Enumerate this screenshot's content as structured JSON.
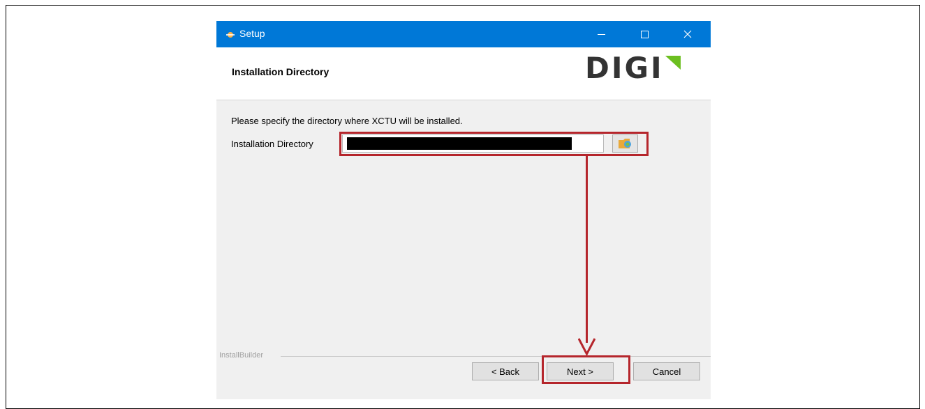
{
  "window": {
    "title": "Setup",
    "icons": {
      "app": "setup-icon",
      "minimize": "minimize-icon",
      "maximize": "maximize-icon",
      "close": "close-icon"
    }
  },
  "header": {
    "title": "Installation Directory",
    "logo_text": "DIGI",
    "logo_accent_color": "#6cbf20"
  },
  "body": {
    "prompt": "Please specify the directory where XCTU will be installed.",
    "directory_label": "Installation Directory",
    "directory_value": "",
    "browse_icon": "folder-icon"
  },
  "footer": {
    "brand": "InstallBuilder",
    "back_label": "< Back",
    "next_label": "Next >",
    "cancel_label": "Cancel"
  },
  "colors": {
    "titlebar": "#0078d7",
    "annotation": "#b5262c"
  }
}
